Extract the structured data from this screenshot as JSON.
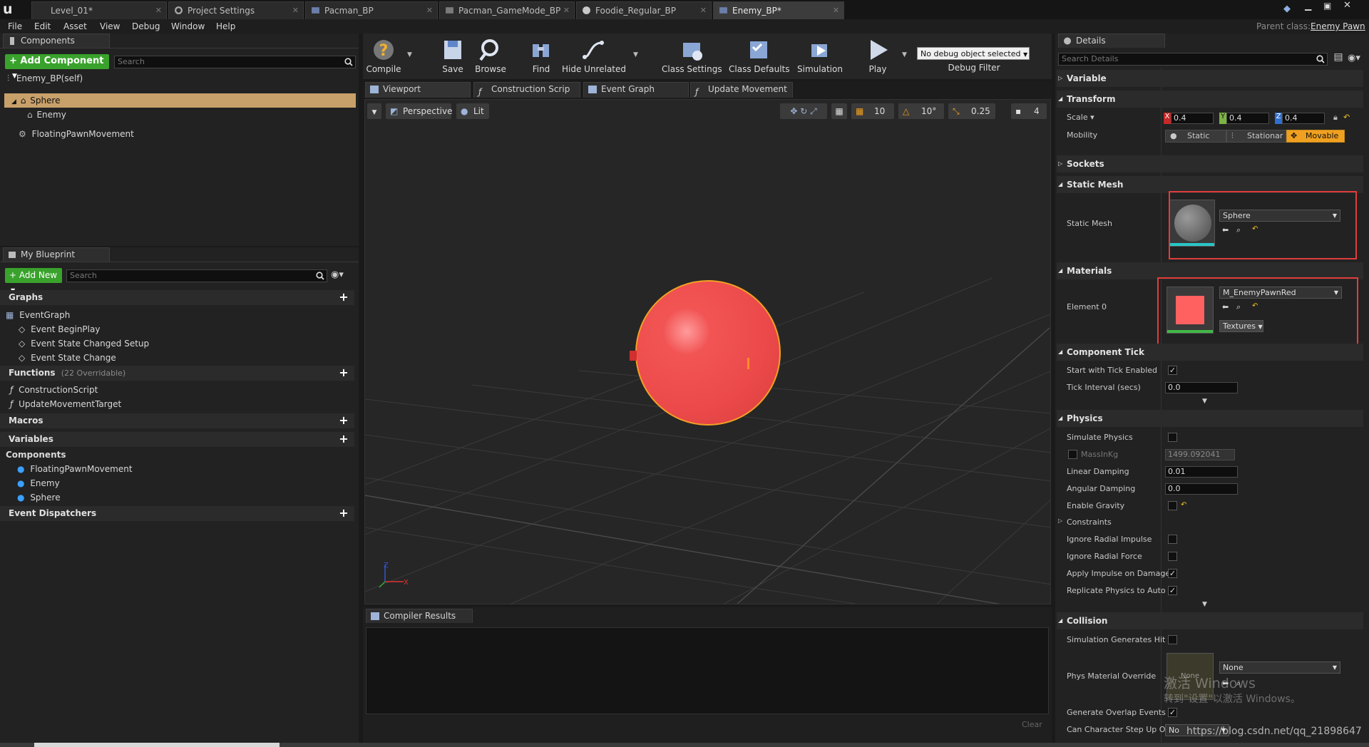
{
  "window": {
    "tabs": [
      "Level_01*",
      "Project Settings",
      "Pacman_BP",
      "Pacman_GameMode_BP",
      "Foodie_Regular_BP",
      "Enemy_BP*"
    ],
    "parent_class_label": "Parent class:",
    "parent_class_value": "Enemy Pawn"
  },
  "menu": [
    "File",
    "Edit",
    "Asset",
    "View",
    "Debug",
    "Window",
    "Help"
  ],
  "components_panel": {
    "tab": "Components",
    "add_button": "+ Add Component",
    "search_placeholder": "Search",
    "self_item": "Enemy_BP(self)",
    "tree": [
      "Sphere",
      "Enemy",
      "FloatingPawnMovement"
    ]
  },
  "my_blueprint": {
    "tab": "My Blueprint",
    "add_new": "+ Add New",
    "search_placeholder": "Search",
    "sections": {
      "graphs": "Graphs",
      "functions": "Functions",
      "functions_count": "(22 Overridable)",
      "macros": "Macros",
      "variables": "Variables",
      "components": "Components",
      "event_dispatchers": "Event Dispatchers"
    },
    "graphs": [
      "EventGraph",
      "Event BeginPlay",
      "Event State Changed Setup",
      "Event State Change"
    ],
    "functions": [
      "ConstructionScript",
      "UpdateMovementTarget"
    ],
    "components": [
      "FloatingPawnMovement",
      "Enemy",
      "Sphere"
    ]
  },
  "toolbar": {
    "buttons": [
      "Compile",
      "Save",
      "Browse",
      "Find",
      "Hide Unrelated",
      "Class Settings",
      "Class Defaults",
      "Simulation",
      "Play"
    ],
    "debug_dropdown": "No debug object selected",
    "debug_filter": "Debug Filter"
  },
  "editor_tabs": [
    "Viewport",
    "Construction Scrip",
    "Event Graph",
    "Update Movement"
  ],
  "viewport": {
    "perspective": "Perspective",
    "lit": "Lit",
    "grid_snap": "10",
    "rot_snap": "10°",
    "scale_snap": "0.25",
    "cam_speed": "4",
    "axis_x": "X",
    "axis_z": "Z"
  },
  "compiler": {
    "tab": "Compiler Results",
    "clear": "Clear"
  },
  "details": {
    "tab": "Details",
    "search_placeholder": "Search Details",
    "categories": {
      "variable": "Variable",
      "transform": "Transform",
      "sockets": "Sockets",
      "static_mesh": "Static Mesh",
      "materials": "Materials",
      "component_tick": "Component Tick",
      "physics": "Physics",
      "collision": "Collision"
    },
    "scale_label": "Scale",
    "scale_x": "0.4",
    "scale_y": "0.4",
    "scale_z": "0.4",
    "mobility_label": "Mobility",
    "mobility_options": [
      "Static",
      "Stationar",
      "Movable"
    ],
    "static_mesh_label": "Static Mesh",
    "static_mesh_value": "Sphere",
    "element0_label": "Element 0",
    "material_value": "M_EnemyPawnRed",
    "textures_btn": "Textures",
    "start_tick_label": "Start with Tick Enabled",
    "tick_interval_label": "Tick Interval (secs)",
    "tick_interval_value": "0.0",
    "simulate_physics": "Simulate Physics",
    "mass_label": "MassInKg",
    "mass_value": "1499.092041",
    "linear_damping_label": "Linear Damping",
    "linear_damping_value": "0.01",
    "angular_damping_label": "Angular Damping",
    "angular_damping_value": "0.0",
    "enable_gravity": "Enable Gravity",
    "constraints": "Constraints",
    "ignore_radial_impulse": "Ignore Radial Impulse",
    "ignore_radial_force": "Ignore Radial Force",
    "apply_impulse": "Apply Impulse on Damage",
    "replicate_physics": "Replicate Physics to Auto",
    "sim_generates_hit": "Simulation Generates Hit",
    "phys_material_label": "Phys Material Override",
    "phys_material_value": "None",
    "thumb_none": "None",
    "generate_overlap": "Generate Overlap Events",
    "can_step_up": "Can Character Step Up On",
    "can_step_up_value": "No"
  },
  "overlay": {
    "watermark_line1": "激活 Windows",
    "watermark_line2": "转到\"设置\"以激活 Windows。",
    "url": "https://blog.csdn.net/qq_21898647"
  },
  "colors": {
    "accent_green": "#39a22c",
    "sphere_red": "#f25454",
    "highlight_orange": "#c8a06a",
    "red_frame": "#e23c3c"
  }
}
